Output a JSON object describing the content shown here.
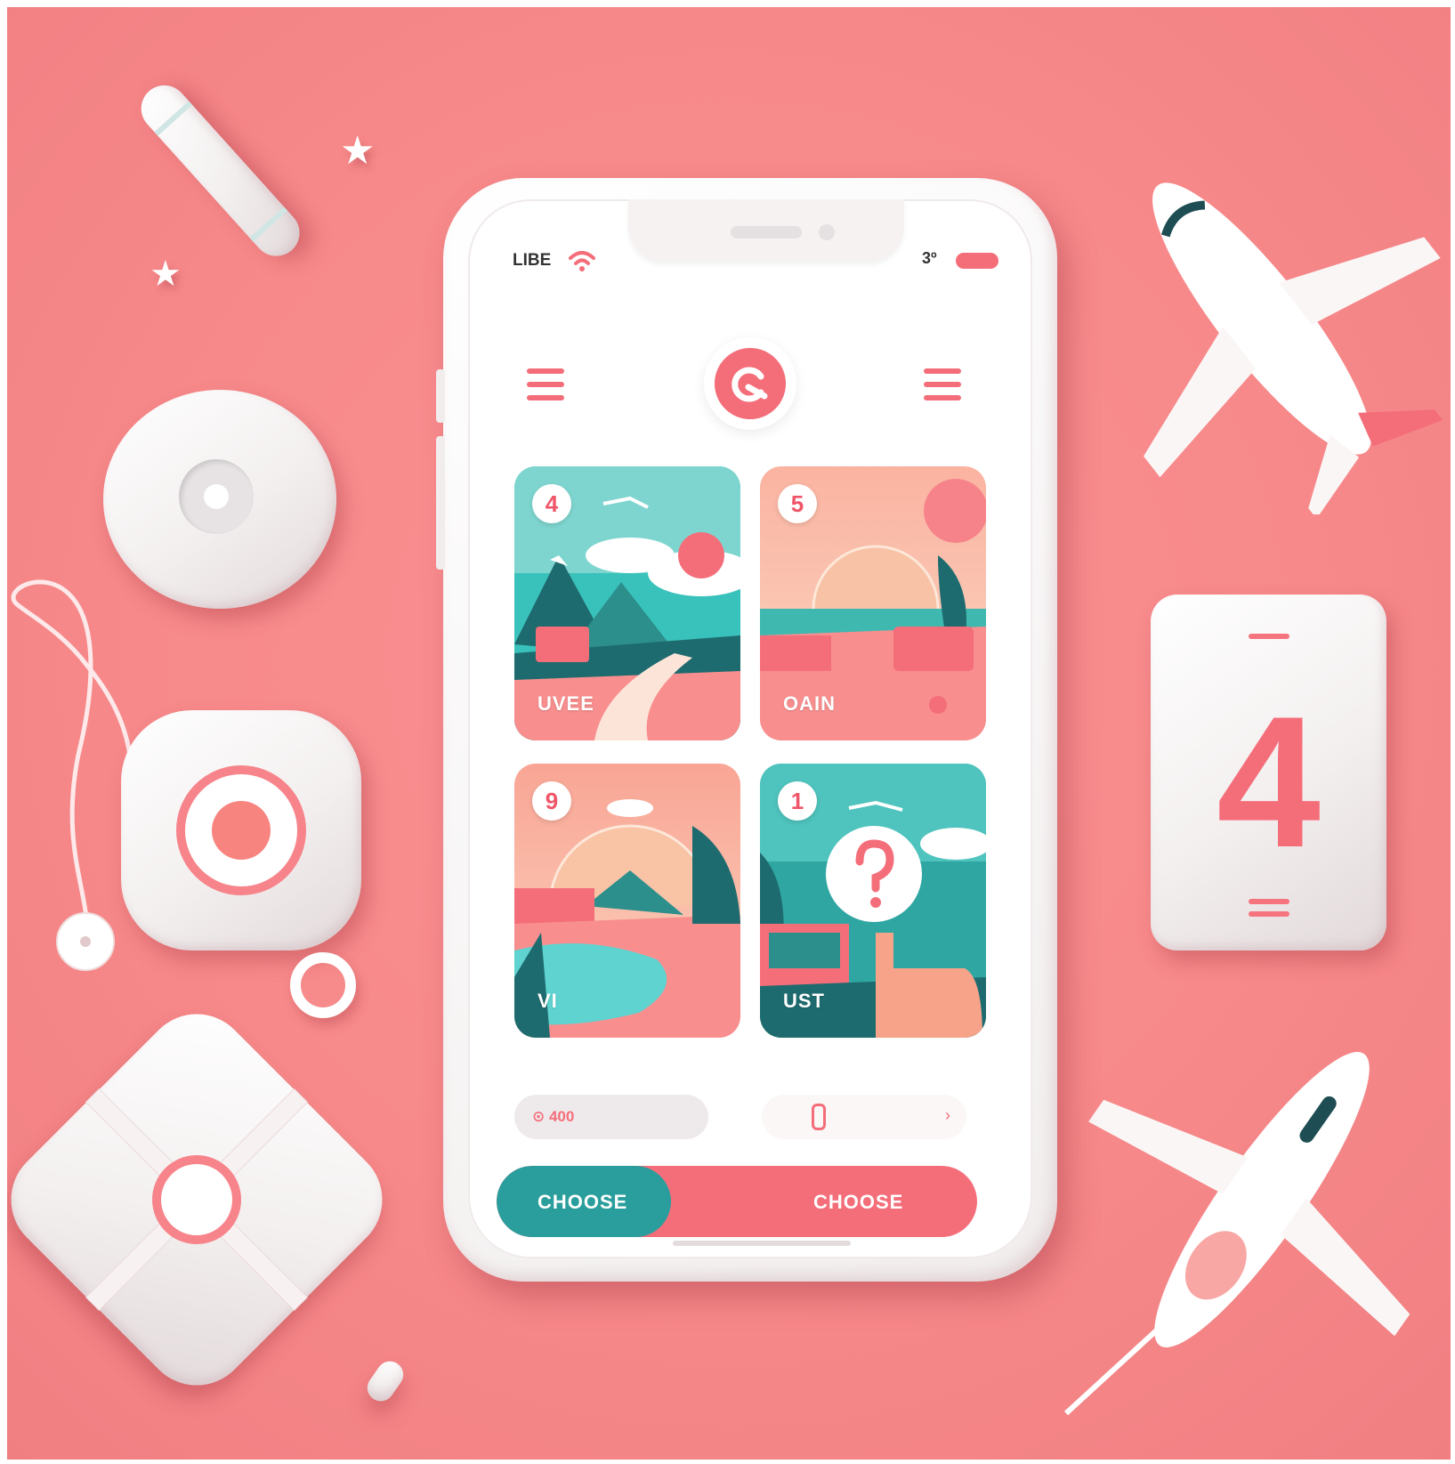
{
  "status_bar": {
    "carrier": "LIBE",
    "battery_text": "3º",
    "wifi_icon": "wifi-icon",
    "battery_icon": "battery-icon"
  },
  "header": {
    "left_menu_icon": "menu-icon",
    "right_menu_icon": "menu-icon",
    "logo_icon": "app-logo-icon"
  },
  "cards": [
    {
      "badge": "4",
      "label": "UVEE",
      "theme": "mountains-road"
    },
    {
      "badge": "5",
      "label": "OAIN",
      "theme": "sunset-beach"
    },
    {
      "badge": "9",
      "label": "VI",
      "theme": "lagoon"
    },
    {
      "badge": "1",
      "label": "UST",
      "theme": "question-hand",
      "overlay_icon": "question-icon"
    }
  ],
  "controls": {
    "left_pill_text": "⊙ 400",
    "right_pill_icon": "phone-icon",
    "right_pill_arrow": "›"
  },
  "choose_bar": {
    "left_label": "CHOOSE",
    "right_label": "CHOOSE"
  },
  "side_card": {
    "number": "4"
  },
  "colors": {
    "background": "#f7898a",
    "accent_coral": "#f46e7a",
    "accent_teal": "#2a9e9c",
    "phone_white": "#ffffff"
  }
}
